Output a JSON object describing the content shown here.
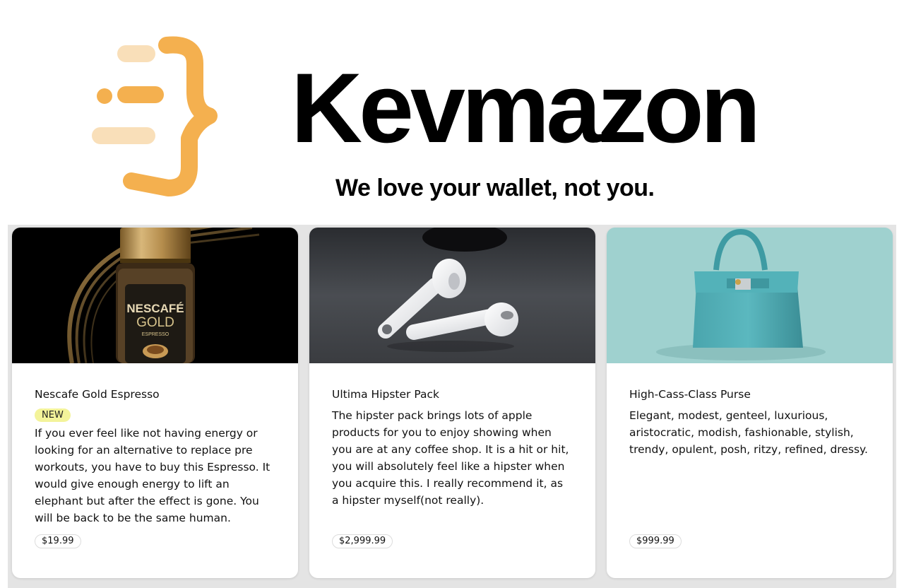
{
  "header": {
    "brand": "Kevmazon",
    "tagline": "We love your wallet, not you."
  },
  "products": [
    {
      "title": "Nescafe Gold Espresso",
      "badge": "NEW",
      "description": "If you ever feel like not having energy or looking for an alternative to replace pre workouts, you have to buy this Espresso. It would give enough energy to lift an elephant but after the effect is gone. You will be back to be the same human.",
      "price": "$19.99",
      "image": {
        "label_line1": "NESCAFÉ",
        "label_line2": "GOLD",
        "label_line3": "ESPRESSO"
      }
    },
    {
      "title": "Ultima Hipster Pack",
      "description": "The hipster pack brings lots of apple products for you to enjoy showing when you are at any coffee shop. It is a hit or hit, you will absolutely feel like a hipster when you acquire this. I really recommend it, as a hipster myself(not really).",
      "price": "$2,999.99"
    },
    {
      "title": "High-Cass-Class Purse",
      "description": "Elegant, modest, genteel, luxurious, aristocratic, modish, fashionable, stylish, trendy, opulent, posh, ritzy, refined, dressy.",
      "price": "$999.99"
    }
  ],
  "colors": {
    "logo_primary": "#f4b04f",
    "logo_light": "#f9dfb9",
    "badge_bg": "#f3f39a",
    "grid_bg": "#e4e4e4"
  }
}
